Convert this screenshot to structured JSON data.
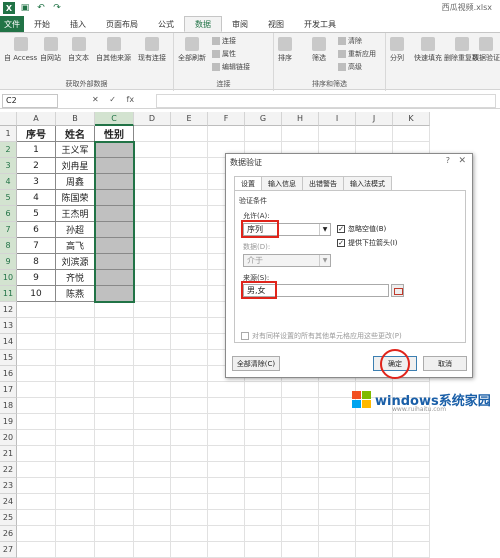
{
  "window": {
    "document_title": "西瓜视频.xlsx",
    "quick_access": [
      "save-icon",
      "undo-icon",
      "redo-icon"
    ]
  },
  "tabs": [
    {
      "label": "开始"
    },
    {
      "label": "插入"
    },
    {
      "label": "页面布局"
    },
    {
      "label": "公式"
    },
    {
      "label": "数据",
      "active": true
    },
    {
      "label": "审阅"
    },
    {
      "label": "视图"
    },
    {
      "label": "开发工具"
    }
  ],
  "file_tab": "文件",
  "ribbon": {
    "get_external": {
      "buttons": [
        "自 Access",
        "自网站",
        "自文本",
        "自其他来源",
        "现有连接"
      ],
      "group_label": "获取外部数据"
    },
    "connections": {
      "refresh_all": "全部刷新",
      "small": [
        "连接",
        "属性",
        "编辑链接"
      ],
      "group_label": "连接"
    },
    "sort_filter": {
      "sort": "排序",
      "filter": "筛选",
      "small": [
        "清除",
        "重新应用",
        "高级"
      ],
      "group_label": "排序和筛选"
    },
    "data_tools": {
      "buttons": [
        "分列",
        "快速填充",
        "删除重复项",
        "数据验证"
      ]
    }
  },
  "formula_bar": {
    "name_box": "C2",
    "cancel_icon": "✕",
    "enter_icon": "✓",
    "fx": "fx",
    "value": ""
  },
  "sheet": {
    "columns": [
      "A",
      "B",
      "C",
      "D",
      "E",
      "F",
      "G",
      "H",
      "I",
      "J",
      "K"
    ],
    "rows": [
      "1",
      "2",
      "3",
      "4",
      "5",
      "6",
      "7",
      "8",
      "9",
      "10",
      "11",
      "12",
      "13",
      "14",
      "15",
      "16",
      "17",
      "18",
      "19",
      "20",
      "21",
      "22",
      "23",
      "24",
      "25",
      "26",
      "27"
    ],
    "headers": {
      "seq": "序号",
      "name": "姓名",
      "gender": "性别"
    },
    "records": [
      {
        "seq": "1",
        "name": "王义军"
      },
      {
        "seq": "2",
        "name": "刘冉星"
      },
      {
        "seq": "3",
        "name": "周鑫"
      },
      {
        "seq": "4",
        "name": "陈国荣"
      },
      {
        "seq": "5",
        "name": "王杰明"
      },
      {
        "seq": "6",
        "name": "孙超"
      },
      {
        "seq": "7",
        "name": "高飞"
      },
      {
        "seq": "8",
        "name": "刘滨源"
      },
      {
        "seq": "9",
        "name": "齐悦"
      },
      {
        "seq": "10",
        "name": "陈燕"
      }
    ]
  },
  "dialog": {
    "title": "数据验证",
    "help": "?",
    "close": "✕",
    "tabs": [
      "设置",
      "输入信息",
      "出错警告",
      "输入法模式"
    ],
    "section_label": "验证条件",
    "allow_label": "允许(A):",
    "allow_value": "序列",
    "ignore_blank": "忽略空值(B)",
    "dropdown_label": "提供下拉箭头(I)",
    "data_label": "数据(D):",
    "data_value": "介于",
    "source_label": "来源(S):",
    "source_value": "男,女",
    "apply_all": "对有同样设置的所有其他单元格应用这些更改(P)",
    "clear_all": "全部清除(C)",
    "ok": "确定",
    "cancel": "取消"
  },
  "watermark": {
    "brand": "windows系统家园",
    "url": "www.ruihaitu.com"
  },
  "colors": {
    "excel_green": "#217346",
    "highlight_red": "#e0241b",
    "shaded_cell": "#c0c0c0"
  }
}
